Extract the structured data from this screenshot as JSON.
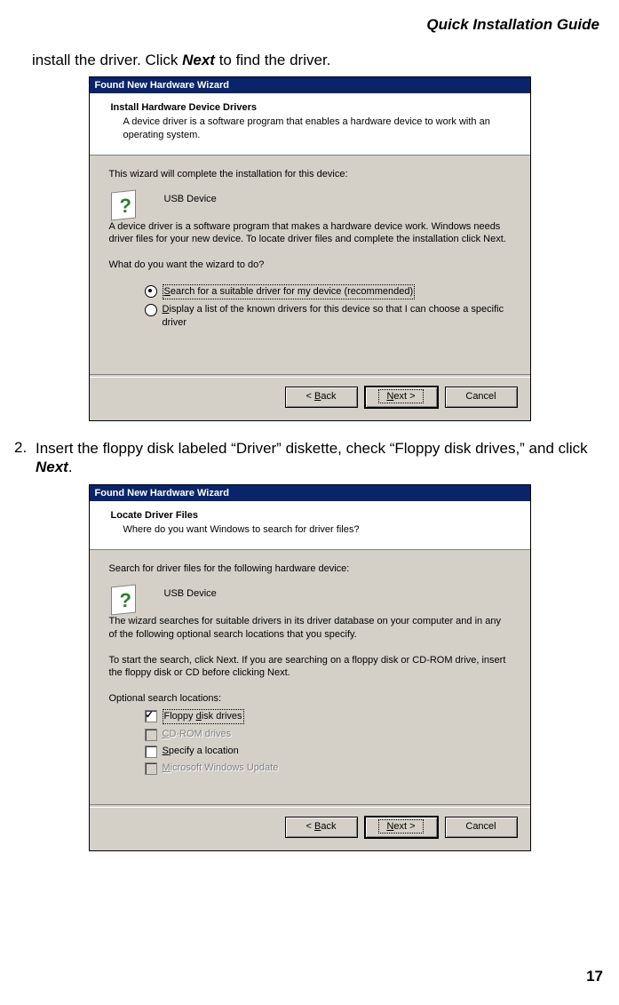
{
  "doc": {
    "header": "Quick Installation Guide",
    "page_number": "17",
    "intro_prefix": "install the driver. Click ",
    "intro_emph": "Next",
    "intro_suffix": " to find the driver.",
    "step2_num": "2.",
    "step2_prefix": "Insert the floppy disk labeled “Driver” diskette, check “Floppy disk drives,” and click ",
    "step2_emph": "Next",
    "step2_suffix": "."
  },
  "dlg1": {
    "title": "Found New Hardware Wizard",
    "banner_title": "Install Hardware Device Drivers",
    "banner_desc": "A device driver is a software program that enables a hardware device to work with an operating system.",
    "line1": "This wizard will complete the installation for this device:",
    "device": "USB Device",
    "line2": "A device driver is a software program that makes a hardware device work. Windows needs driver files for your new device. To locate driver files and complete the installation click Next.",
    "line3": "What do you want the wizard to do?",
    "opt1": "Search for a suitable driver for my device (recommended)",
    "opt2": "Display a list of the known drivers for this device so that I can choose a specific driver",
    "back": "< Back",
    "next": "Next >",
    "cancel": "Cancel"
  },
  "dlg2": {
    "title": "Found New Hardware Wizard",
    "banner_title": "Locate Driver Files",
    "banner_desc": "Where do you want Windows to search for driver files?",
    "line1": "Search for driver files for the following hardware device:",
    "device": "USB Device",
    "line2": "The wizard searches for suitable drivers in its driver database on your computer and in any of the following optional search locations that you specify.",
    "line3": "To start the search, click Next. If you are searching on a floppy disk or CD-ROM drive, insert the floppy disk or CD before clicking Next.",
    "line4": "Optional search locations:",
    "chk1": "Floppy disk drives",
    "chk2": "CD-ROM drives",
    "chk3": "Specify a location",
    "chk4": "Microsoft Windows Update",
    "back": "< Back",
    "next": "Next >",
    "cancel": "Cancel"
  }
}
